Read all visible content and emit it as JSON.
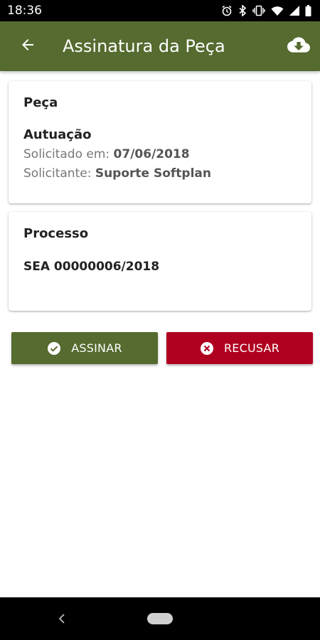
{
  "status_bar": {
    "time": "18:36",
    "icons": [
      "alarm-icon",
      "bluetooth-icon",
      "vibrate-icon",
      "wifi-icon",
      "signal-icon",
      "battery-icon"
    ]
  },
  "app_bar": {
    "title": "Assinatura da Peça",
    "back_icon": "arrow-back-icon",
    "download_icon": "cloud-download-icon",
    "background": "#556b2f"
  },
  "peca_card": {
    "title": "Peça",
    "subject": "Autuação",
    "requested_label": "Solicitado em:",
    "requested_date": "07/06/2018",
    "requester_label": "Solicitante:",
    "requester_name": "Suporte Softplan"
  },
  "processo_card": {
    "title": "Processo",
    "number": "SEA 00000006/2018"
  },
  "actions": {
    "sign_label": "ASSINAR",
    "sign_color": "#556b2f",
    "refuse_label": "RECUSAR",
    "refuse_color": "#b00020"
  }
}
